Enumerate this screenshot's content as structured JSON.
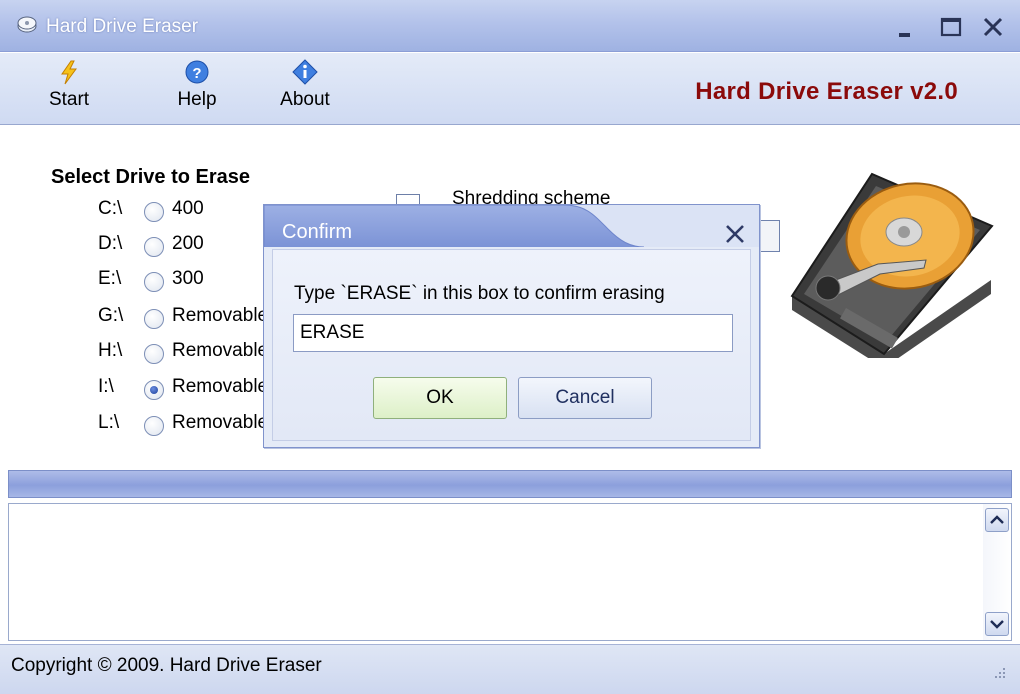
{
  "window": {
    "title": "Hard Drive Eraser"
  },
  "toolbar": {
    "items": [
      {
        "label": "Start",
        "icon": "lightning-icon"
      },
      {
        "label": "Help",
        "icon": "help-icon"
      },
      {
        "label": "About",
        "icon": "info-icon"
      }
    ],
    "brand": "Hard Drive Eraser v2.0"
  },
  "main": {
    "section_title": "Select Drive to Erase",
    "drives": [
      {
        "letter": "C:\\",
        "size": "400",
        "selected": false
      },
      {
        "letter": "D:\\",
        "size": "200",
        "selected": false
      },
      {
        "letter": "E:\\",
        "size": "300",
        "selected": false
      },
      {
        "letter": "G:\\",
        "size": "Removable",
        "selected": false
      },
      {
        "letter": "H:\\",
        "size": "Removable",
        "selected": false
      },
      {
        "letter": "I:\\",
        "size": "Removable",
        "selected": true
      },
      {
        "letter": "L:\\",
        "size": "Removable",
        "selected": false
      }
    ],
    "scheme_label": "Shredding scheme"
  },
  "dialog": {
    "title": "Confirm",
    "prompt": "Type `ERASE` in this box to confirm erasing",
    "input_value": "ERASE",
    "ok_label": "OK",
    "cancel_label": "Cancel"
  },
  "status": {
    "copyright": "Copyright © 2009. Hard Drive Eraser"
  },
  "colors": {
    "brand": "#8b0a0a",
    "titlebar": "#b3c2ea",
    "progress": "#8c9fdc"
  }
}
